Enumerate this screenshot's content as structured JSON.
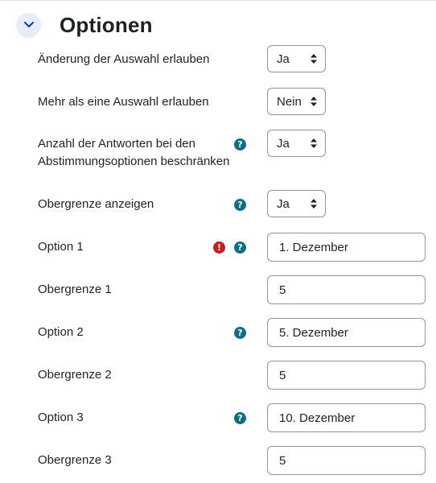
{
  "section": {
    "title": "Optionen"
  },
  "fields": {
    "allow_update": {
      "label": "Änderung der Auswahl erlauben",
      "value": "Ja"
    },
    "allow_multiple": {
      "label": "Mehr als eine Auswahl erlauben",
      "value": "Nein"
    },
    "limit_answers": {
      "label": "Anzahl der Antworten bei den Abstimmungsoptionen beschränken",
      "value": "Ja"
    },
    "show_limit": {
      "label": "Obergrenze anzeigen",
      "value": "Ja"
    },
    "option1": {
      "label": "Option 1",
      "value": "1. Dezember"
    },
    "limit1": {
      "label": "Obergrenze 1",
      "value": "5"
    },
    "option2": {
      "label": "Option 2",
      "value": "5. Dezember"
    },
    "limit2": {
      "label": "Obergrenze 2",
      "value": "5"
    },
    "option3": {
      "label": "Option 3",
      "value": "10. Dezember"
    },
    "limit3": {
      "label": "Obergrenze 3",
      "value": "5"
    }
  },
  "icons": {
    "help": "?",
    "error": "!"
  },
  "colors": {
    "help": "#0f6e84",
    "error": "#c81e1e",
    "border": "#8f959e",
    "collapse_bg": "#e7ecf8",
    "accent": "#0f47ad"
  }
}
